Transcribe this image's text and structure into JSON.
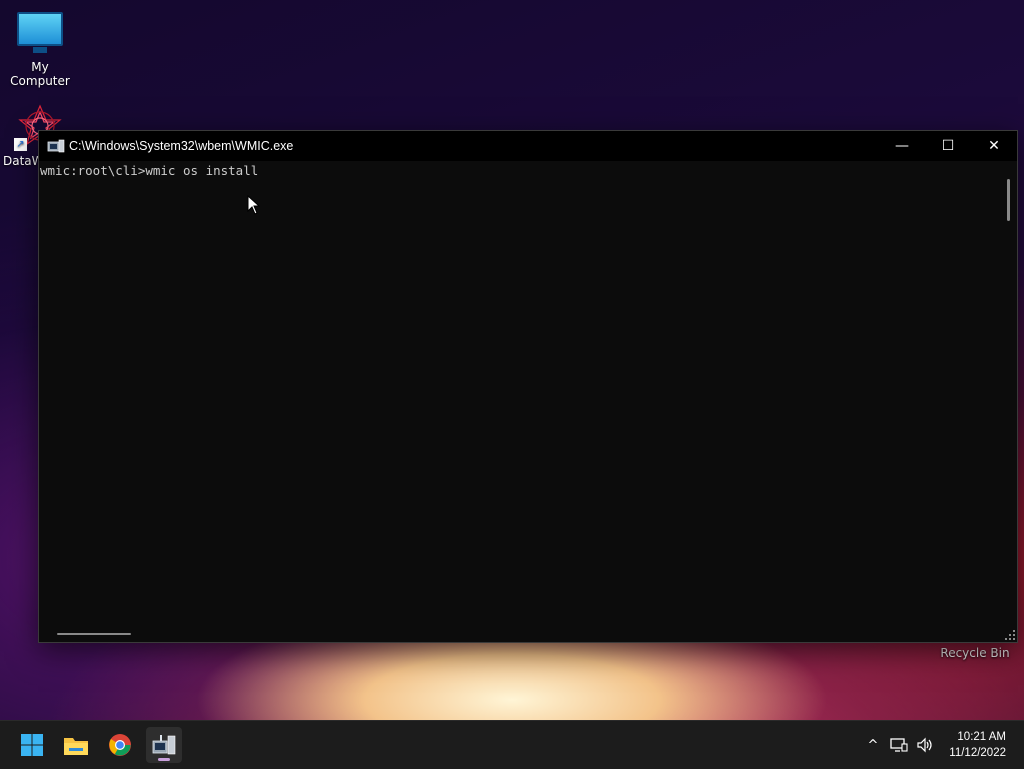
{
  "desktop": {
    "icons": [
      {
        "label": "My Computer"
      },
      {
        "label": "DataW"
      },
      {
        "label": "Recycle Bin"
      }
    ]
  },
  "window": {
    "title": "C:\\Windows\\System32\\wbem\\WMIC.exe",
    "controls": {
      "minimize": "—",
      "maximize": "☐",
      "close": "✕"
    },
    "console_lines": [
      "wmic:root\\cli>wmic os install"
    ]
  },
  "taskbar": {
    "apps": [
      {
        "name": "start-button",
        "icon": "windows-logo-icon"
      },
      {
        "name": "file-explorer",
        "icon": "folder-icon"
      },
      {
        "name": "chrome",
        "icon": "chrome-icon"
      },
      {
        "name": "wmic",
        "icon": "wmic-app-icon",
        "active": true
      }
    ],
    "tray": {
      "chevron": "^",
      "network": "network-icon",
      "volume": "volume-icon"
    },
    "clock": {
      "time": "10:21 AM",
      "date": "11/12/2022"
    }
  },
  "colors": {
    "console_bg": "#0c0c0c",
    "console_text": "#cccccc",
    "taskbar_bg": "#1c1c1c",
    "accent": "#c9a0dc"
  }
}
